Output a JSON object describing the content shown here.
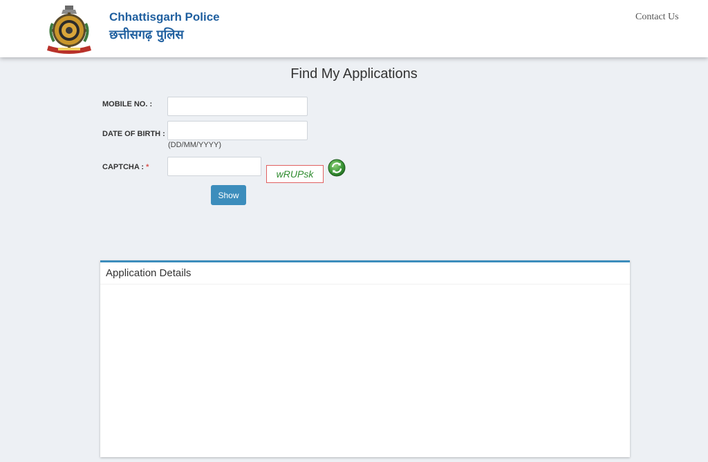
{
  "header": {
    "brand_en": "Chhattisgarh Police",
    "brand_hi": "छत्तीसगढ़ पुलिस",
    "contact_label": "Contact Us",
    "logo_icon": "police-emblem-icon"
  },
  "page": {
    "title": "Find My Applications"
  },
  "form": {
    "mobile_label": "MOBILE NO. :",
    "mobile_value": "",
    "dob_label": "DATE OF BIRTH :",
    "dob_value": "",
    "dob_hint": "(DD/MM/YYYY)",
    "captcha_label": "CAPTCHA :",
    "captcha_required": "*",
    "captcha_value": "",
    "captcha_text": "wRUPsk",
    "refresh_icon": "refresh-icon",
    "show_label": "Show"
  },
  "panel": {
    "title": "Application Details"
  },
  "colors": {
    "brand": "#1f5f9f",
    "accent": "#3c8dbc",
    "background": "#edf0f4",
    "captcha_text": "#2e8b2e",
    "captcha_border": "#e06060",
    "required": "#d9534f"
  }
}
